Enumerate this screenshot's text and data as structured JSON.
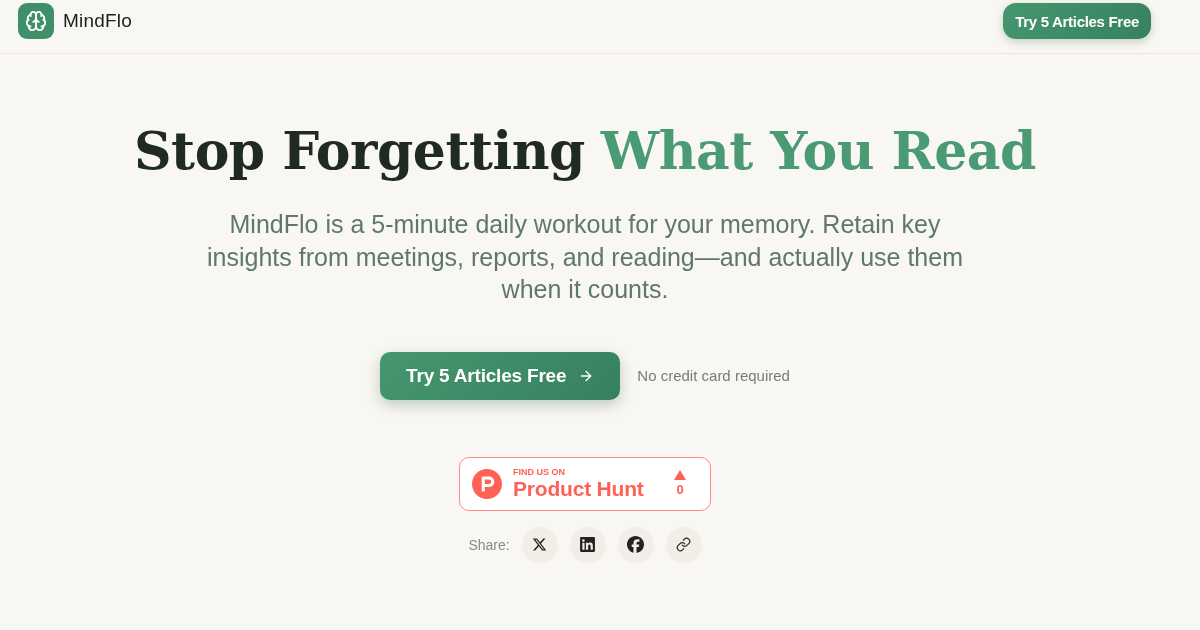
{
  "header": {
    "brand": "MindFlo",
    "cta": "Try 5 Articles Free"
  },
  "hero": {
    "title": [
      {
        "text": "Stop Forgetting",
        "accent": false
      },
      {
        "text": "What You Read",
        "accent": true
      }
    ],
    "subtitle": "MindFlo is a 5-minute daily workout for your memory. Retain key insights from meetings, reports, and reading—and actually use them when it counts.",
    "cta": "Try 5 Articles Free",
    "note": "No credit card required"
  },
  "product_hunt": {
    "kicker": "FIND US ON",
    "name": "Product Hunt",
    "votes": "0"
  },
  "share": {
    "label": "Share:",
    "links": [
      {
        "kind": "x"
      },
      {
        "kind": "linkedin"
      },
      {
        "kind": "facebook"
      },
      {
        "kind": "link"
      }
    ]
  }
}
